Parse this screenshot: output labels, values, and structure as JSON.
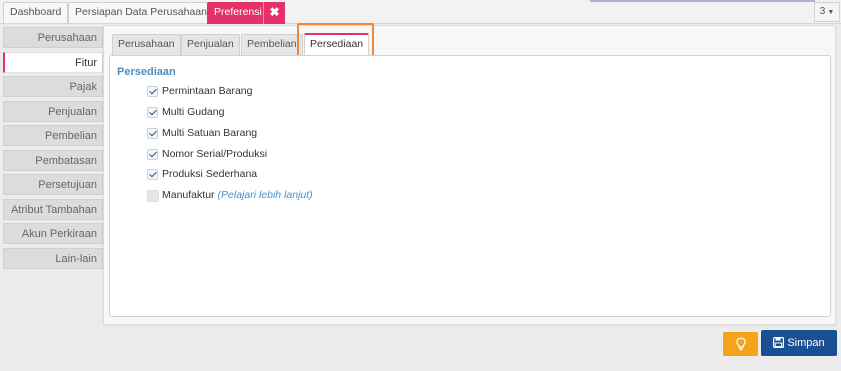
{
  "top_tabs": [
    {
      "label": "Dashboard"
    },
    {
      "label": "Persiapan Data Perusahaan"
    },
    {
      "label": "Preferensi",
      "active": true
    }
  ],
  "tab_close_icon": "close-icon",
  "tab_counter": {
    "value": "3",
    "icon": "chevron-down-icon"
  },
  "sidebar": {
    "items": [
      {
        "label": "Perusahaan"
      },
      {
        "label": "Fitur",
        "active": true
      },
      {
        "label": "Pajak"
      },
      {
        "label": "Penjualan"
      },
      {
        "label": "Pembelian"
      },
      {
        "label": "Pembatasan"
      },
      {
        "label": "Persetujuan"
      },
      {
        "label": "Atribut Tambahan"
      },
      {
        "label": "Akun Perkiraan"
      },
      {
        "label": "Lain-lain"
      }
    ]
  },
  "sub_tabs": [
    {
      "label": "Perusahaan"
    },
    {
      "label": "Penjualan"
    },
    {
      "label": "Pembelian"
    },
    {
      "label": "Persediaan",
      "active": true
    }
  ],
  "section": {
    "title": "Persediaan",
    "options": [
      {
        "label": "Permintaan Barang",
        "checked": true
      },
      {
        "label": "Multi Gudang",
        "checked": true
      },
      {
        "label": "Multi Satuan Barang",
        "checked": true
      },
      {
        "label": "Nomor Serial/Produksi",
        "checked": true
      },
      {
        "label": "Produksi Sederhana",
        "checked": true
      },
      {
        "label": "Manufaktur",
        "checked": false,
        "link": "(Pelajari lebih lanjut)"
      }
    ]
  },
  "buttons": {
    "bulb_icon": "lightbulb-icon",
    "save_label": "Simpan",
    "save_icon": "floppy-disk-icon"
  },
  "colors": {
    "accent_pink": "#e5316a",
    "highlight_orange": "#f0883e",
    "link_blue": "#4a8fc5",
    "save_blue": "#1b4f93",
    "bulb_orange": "#f4a41a"
  }
}
